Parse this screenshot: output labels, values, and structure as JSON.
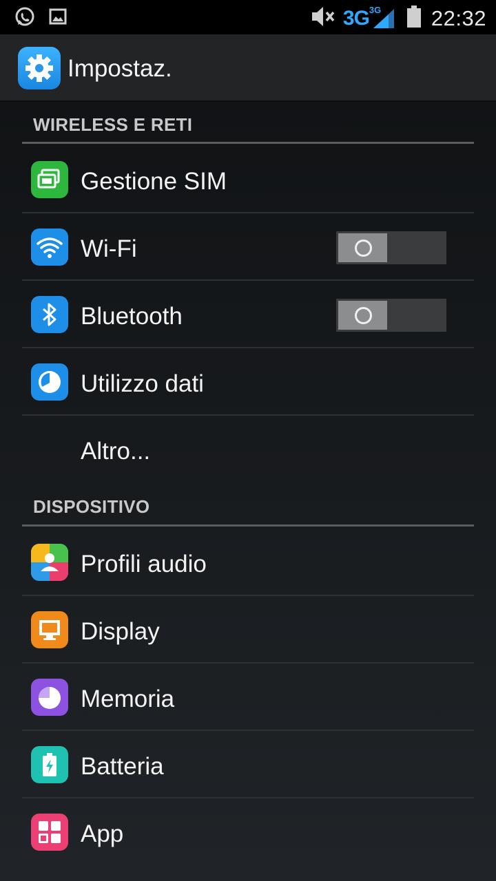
{
  "status_bar": {
    "time": "22:32",
    "network": "3G",
    "network_small": "3G",
    "icons": [
      "whatsapp-icon",
      "gallery-icon",
      "mute-icon",
      "signal-icon",
      "battery-icon"
    ]
  },
  "action_bar": {
    "title": "Impostaz.",
    "icon": "settings-gear-icon"
  },
  "sections": [
    {
      "header": "WIRELESS E RETI",
      "items": [
        {
          "label": "Gestione SIM",
          "icon": "sim-icon",
          "color": "#2db83d"
        },
        {
          "label": "Wi-Fi",
          "icon": "wifi-icon",
          "color": "#1e8fe8",
          "toggle": "off"
        },
        {
          "label": "Bluetooth",
          "icon": "bluetooth-icon",
          "color": "#1e8fe8",
          "toggle": "off"
        },
        {
          "label": "Utilizzo dati",
          "icon": "data-usage-icon",
          "color": "#1e8fe8"
        },
        {
          "label": "Altro...",
          "icon": null
        }
      ]
    },
    {
      "header": "DISPOSITIVO",
      "items": [
        {
          "label": "Profili audio",
          "icon": "audio-profiles-icon",
          "color": "#2e9be8"
        },
        {
          "label": "Display",
          "icon": "display-icon",
          "color": "#f08a1a"
        },
        {
          "label": "Memoria",
          "icon": "memory-icon",
          "color": "#8e52e0"
        },
        {
          "label": "Batteria",
          "icon": "battery-settings-icon",
          "color": "#1fc2b0"
        },
        {
          "label": "App",
          "icon": "apps-icon",
          "color": "#ec3f74"
        }
      ]
    }
  ]
}
